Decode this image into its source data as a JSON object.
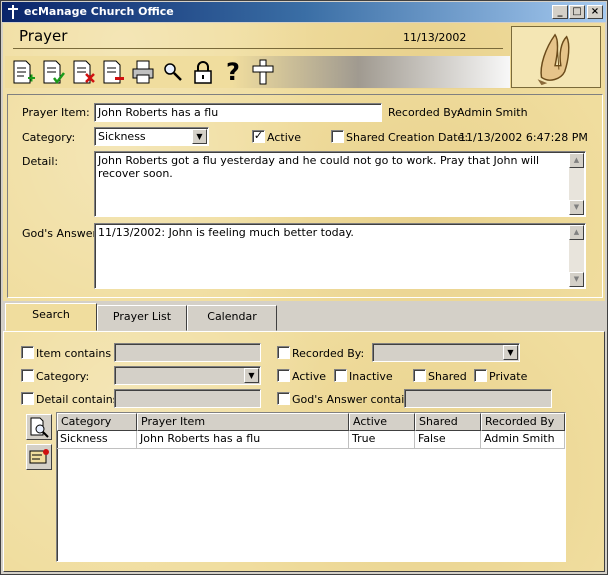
{
  "window": {
    "title": "ecManage Church Office",
    "minimize_label": "_",
    "maximize_label": "□",
    "close_label": "×"
  },
  "header": {
    "page_title": "Prayer",
    "date": "11/13/2002"
  },
  "toolbar": {
    "buttons": [
      "new-icon",
      "save-icon",
      "delete-icon",
      "remove-icon",
      "print-icon",
      "search-icon",
      "lock-icon",
      "help-icon",
      "cross-icon"
    ],
    "help_glyph": "?"
  },
  "detail": {
    "prayer_item_label": "Prayer Item:",
    "prayer_item_value": "John Roberts has a flu",
    "recorded_by_label": "Recorded By:",
    "recorded_by_value": "Admin Smith",
    "category_label": "Category:",
    "category_value": "Sickness",
    "active_label": "Active",
    "active_checked": true,
    "shared_label": "Shared",
    "shared_checked": false,
    "creation_date_label": "Creation Date:",
    "creation_date_value": "11/13/2002 6:47:28 PM",
    "detail_label": "Detail:",
    "detail_value": "John Roberts got a flu yesterday and he could not go to work.  Pray that John will recover soon.",
    "gods_answer_label": "God's Answer:",
    "gods_answer_value": "11/13/2002: John is feeling much better today."
  },
  "tabs": [
    {
      "label": "Search",
      "active": true
    },
    {
      "label": "Prayer List",
      "active": false
    },
    {
      "label": "Calendar",
      "active": false
    }
  ],
  "search": {
    "item_contains_label": "Item contains",
    "recorded_by_label": "Recorded By:",
    "category_label": "Category:",
    "active_label": "Active",
    "inactive_label": "Inactive",
    "shared_label": "Shared",
    "private_label": "Private",
    "detail_contains_label": "Detail contains",
    "gods_answer_contains_label": "God's Answer contains"
  },
  "results": {
    "columns": [
      "Category",
      "Prayer Item",
      "Active",
      "Shared",
      "Recorded By"
    ],
    "rows": [
      [
        "Sickness",
        "John Roberts has a flu",
        "True",
        "False",
        "Admin Smith"
      ]
    ]
  },
  "colors": {
    "parchment": "#f0dd9e",
    "titlebar": "#0a246a",
    "face": "#d4d0c8"
  }
}
